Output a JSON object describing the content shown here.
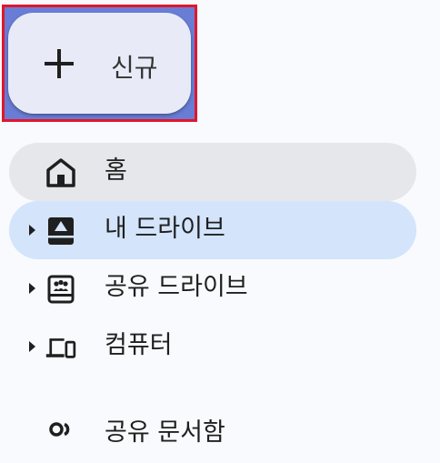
{
  "new_button": {
    "label": "신규"
  },
  "nav": {
    "home": {
      "label": "홈"
    },
    "my_drive": {
      "label": "내 드라이브"
    },
    "shared_drives": {
      "label": "공유 드라이브"
    },
    "computers": {
      "label": "컴퓨터"
    },
    "shared_with_me": {
      "label": "공유 문서함"
    }
  },
  "colors": {
    "background": "#f8fafd",
    "new_button_bg": "#e8ebf7",
    "highlight_border": "#e0172b",
    "home_bg": "#e6e7ea",
    "selected_bg": "#d3e4fb"
  },
  "icons": {
    "new": "plus-icon",
    "home": "home-icon",
    "my_drive": "drive-icon",
    "shared_drives": "shared-drive-icon",
    "computers": "computers-icon",
    "shared_with_me": "people-icon"
  }
}
